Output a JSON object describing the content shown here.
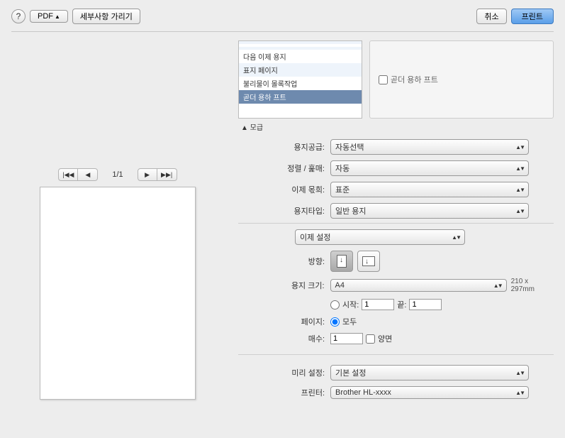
{
  "topbar": {
    "help": "?",
    "pdf": "PDF",
    "details": "세부사항 가리기",
    "cancel": "취소",
    "print": "프린트"
  },
  "list": {
    "items": [
      "",
      "",
      "",
      "다음 이제 용지",
      "표지 페이지",
      "불리물이 몰록작업",
      "곧더 용하 프트"
    ],
    "selectedIndex": 6
  },
  "checkpanel": {
    "label": "곧더 용하 프트"
  },
  "section": "▲ 모급",
  "form": {
    "mediaSource": {
      "label": "용지공급:",
      "value": "자동선택"
    },
    "sortCollate": {
      "label": "정렬 / 훑매:",
      "value": "자동"
    },
    "nowCheck": {
      "label": "이제 몫희:",
      "value": "표준"
    },
    "paperType": {
      "label": "용지타입:",
      "value": "일반 용지"
    }
  },
  "centerSelect": "이제 설정",
  "orientation": {
    "label": "방향:"
  },
  "paperSize": {
    "label": "용지 크기:",
    "value": "A4",
    "dims": "210 x 297mm"
  },
  "pages": {
    "label": "페이지:",
    "allLabel": "모두",
    "fromLabel": "시작:",
    "fromValue": "1",
    "toLabel": "끝:",
    "toValue": "1"
  },
  "copies": {
    "label": "매수:",
    "value": "1",
    "collate": "양면"
  },
  "preset": {
    "label": "미리 설정:",
    "value": "기본 설정"
  },
  "printer": {
    "label": "프린터:",
    "value": "Brother HL-xxxx"
  },
  "preview": {
    "pageIndicator": "1/1"
  }
}
